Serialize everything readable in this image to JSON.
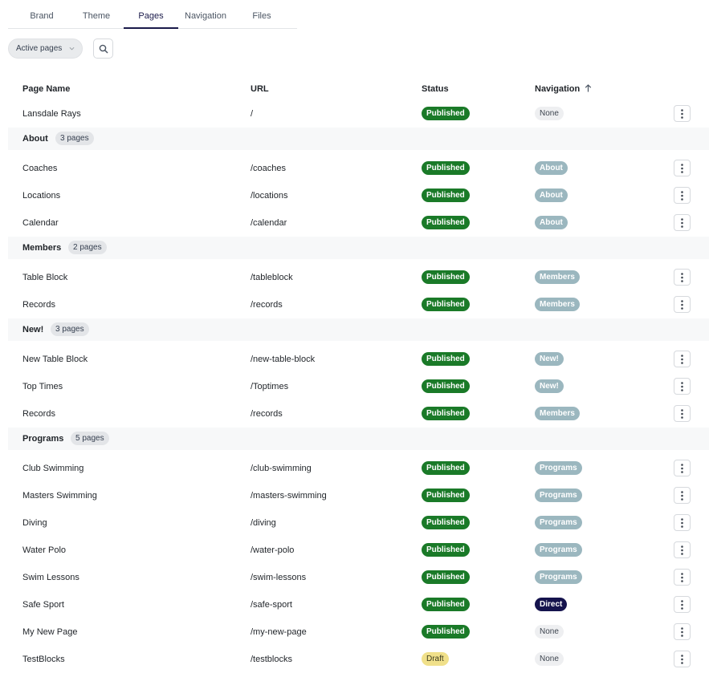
{
  "tabs": [
    "Brand",
    "Theme",
    "Pages",
    "Navigation",
    "Files"
  ],
  "active_tab": "Pages",
  "filter": {
    "label": "Active pages"
  },
  "columns": {
    "page_name": "Page Name",
    "url": "URL",
    "status": "Status",
    "navigation": "Navigation"
  },
  "colors": {
    "published": "#1a7a28",
    "draft": "#f0e08a",
    "nav_group": "#9bb7bf",
    "nav_direct": "#15134d",
    "nav_none": "#eeeff1",
    "active_tab": "#1a1a4a"
  },
  "rows": [
    {
      "kind": "page",
      "name": "Lansdale Rays",
      "url": "/",
      "status": "Published",
      "nav": "None",
      "nav_style": "none"
    },
    {
      "kind": "group",
      "name": "About",
      "count": "3 pages"
    },
    {
      "kind": "page",
      "name": "Coaches",
      "url": "/coaches",
      "status": "Published",
      "nav": "About",
      "nav_style": "group"
    },
    {
      "kind": "page",
      "name": "Locations",
      "url": "/locations",
      "status": "Published",
      "nav": "About",
      "nav_style": "group"
    },
    {
      "kind": "page",
      "name": "Calendar",
      "url": "/calendar",
      "status": "Published",
      "nav": "About",
      "nav_style": "group"
    },
    {
      "kind": "group",
      "name": "Members",
      "count": "2 pages"
    },
    {
      "kind": "page",
      "name": "Table Block",
      "url": "/tableblock",
      "status": "Published",
      "nav": "Members",
      "nav_style": "group"
    },
    {
      "kind": "page",
      "name": "Records",
      "url": "/records",
      "status": "Published",
      "nav": "Members",
      "nav_style": "group"
    },
    {
      "kind": "group",
      "name": "New!",
      "count": "3 pages"
    },
    {
      "kind": "page",
      "name": "New Table Block",
      "url": "/new-table-block",
      "status": "Published",
      "nav": "New!",
      "nav_style": "group"
    },
    {
      "kind": "page",
      "name": "Top Times",
      "url": "/Toptimes",
      "status": "Published",
      "nav": "New!",
      "nav_style": "group"
    },
    {
      "kind": "page",
      "name": "Records",
      "url": "/records",
      "status": "Published",
      "nav": "Members",
      "nav_style": "group"
    },
    {
      "kind": "group",
      "name": "Programs",
      "count": "5 pages"
    },
    {
      "kind": "page",
      "name": "Club Swimming",
      "url": "/club-swimming",
      "status": "Published",
      "nav": "Programs",
      "nav_style": "group"
    },
    {
      "kind": "page",
      "name": "Masters Swimming",
      "url": "/masters-swimming",
      "status": "Published",
      "nav": "Programs",
      "nav_style": "group"
    },
    {
      "kind": "page",
      "name": "Diving",
      "url": "/diving",
      "status": "Published",
      "nav": "Programs",
      "nav_style": "group"
    },
    {
      "kind": "page",
      "name": "Water Polo",
      "url": "/water-polo",
      "status": "Published",
      "nav": "Programs",
      "nav_style": "group"
    },
    {
      "kind": "page",
      "name": "Swim Lessons",
      "url": "/swim-lessons",
      "status": "Published",
      "nav": "Programs",
      "nav_style": "group"
    },
    {
      "kind": "page",
      "name": "Safe Sport",
      "url": "/safe-sport",
      "status": "Published",
      "nav": "Direct",
      "nav_style": "direct"
    },
    {
      "kind": "page",
      "name": "My New Page",
      "url": "/my-new-page",
      "status": "Published",
      "nav": "None",
      "nav_style": "none"
    },
    {
      "kind": "page",
      "name": "TestBlocks",
      "url": "/testblocks",
      "status": "Draft",
      "nav": "None",
      "nav_style": "none"
    }
  ]
}
